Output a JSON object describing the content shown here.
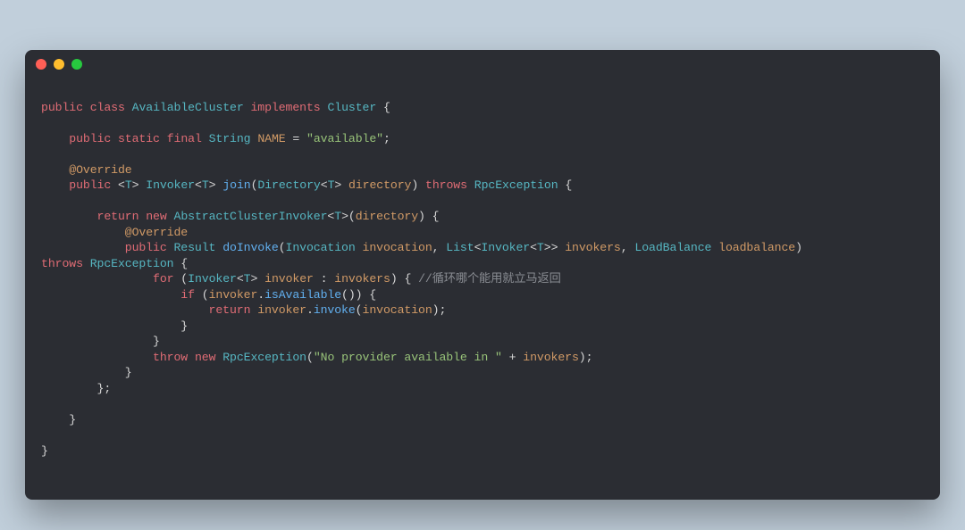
{
  "code": {
    "l1": {
      "kw1": "public",
      "kw2": "class",
      "t1": "AvailableCluster",
      "kw3": "implements",
      "t2": "Cluster",
      "p": " {"
    },
    "l3": {
      "kw1": "public",
      "kw2": "static",
      "kw3": "final",
      "t1": "String",
      "id1": "NAME",
      "eq": " = ",
      "s1": "\"available\"",
      "p": ";"
    },
    "l5": {
      "ann": "@Override"
    },
    "l6": {
      "kw1": "public",
      "g1": "<",
      "t1": "T",
      "g2": ">",
      "t2": "Invoker",
      "g3": "<",
      "t3": "T",
      "g4": ">",
      "fn": "join",
      "p1": "(",
      "t4": "Directory",
      "g5": "<",
      "t5": "T",
      "g6": ">",
      "id1": "directory",
      "p2": ")",
      "kw2": "throws",
      "t6": "RpcException",
      "p3": " {"
    },
    "l8": {
      "kw1": "return",
      "kw2": "new",
      "t1": "AbstractClusterInvoker",
      "g1": "<",
      "t2": "T",
      "g2": ">(",
      "id1": "directory",
      "p1": ") {"
    },
    "l9": {
      "ann": "@Override"
    },
    "l10": {
      "kw1": "public",
      "t1": "Result",
      "fn": "doInvoke",
      "p1": "(",
      "t2": "Invocation",
      "id1": "invocation",
      "p2": ", ",
      "t3": "List",
      "g1": "<",
      "t4": "Invoker",
      "g2": "<",
      "t5": "T",
      "g3": ">>",
      "id2": "invokers",
      "p3": ", ",
      "t6": "LoadBalance",
      "id3": "loadbalance",
      "p4": ") "
    },
    "l10b": {
      "kw1": "throws",
      "t1": "RpcException",
      "p1": " {"
    },
    "l11": {
      "kw1": "for",
      "p1": " (",
      "t1": "Invoker",
      "g1": "<",
      "t2": "T",
      "g2": ">",
      "id1": "invoker",
      "p2": " : ",
      "id2": "invokers",
      "p3": ") { ",
      "cmt": "//循环哪个能用就立马返回"
    },
    "l12": {
      "kw1": "if",
      "p1": " (",
      "id1": "invoker",
      "p2": ".",
      "fn": "isAvailable",
      "p3": "()) {"
    },
    "l13": {
      "kw1": "return",
      "id1": "invoker",
      "p1": ".",
      "fn": "invoke",
      "p2": "(",
      "id2": "invocation",
      "p3": ");"
    },
    "l14": {
      "p": "}"
    },
    "l15": {
      "p": "}"
    },
    "l16": {
      "kw1": "throw",
      "kw2": "new",
      "t1": "RpcException",
      "p1": "(",
      "s1": "\"No provider available in \"",
      "p2": " + ",
      "id1": "invokers",
      "p3": ");"
    },
    "l17": {
      "p": "}"
    },
    "l18": {
      "p": "};"
    },
    "l20": {
      "p": "}"
    },
    "l22": {
      "p": "}"
    }
  },
  "window": {
    "dots": {
      "red": "#ff5f56",
      "yellow": "#ffbd2e",
      "green": "#27c93f"
    }
  }
}
